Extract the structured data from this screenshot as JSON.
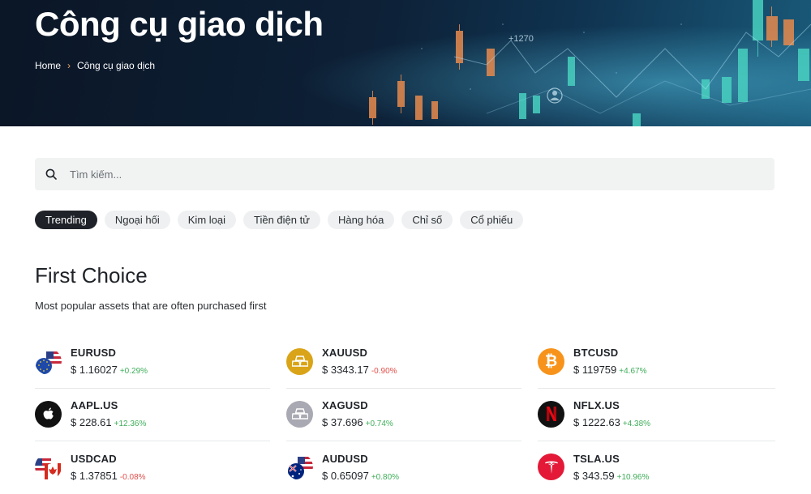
{
  "header": {
    "title": "Công cụ giao dịch",
    "breadcrumb": {
      "home": "Home",
      "separator": "›",
      "current": "Công cụ giao dịch"
    },
    "chart_labels": {
      "price_tag": "+1270"
    }
  },
  "search": {
    "placeholder": "Tìm kiếm..."
  },
  "categories": [
    "Trending",
    "Ngoại hối",
    "Kim loại",
    "Tiền điện tử",
    "Hàng hóa",
    "Chỉ số",
    "Cổ phiếu"
  ],
  "active_category": "Trending",
  "section": {
    "title": "First Choice",
    "subtitle": "Most popular assets that are often purchased first"
  },
  "assets": [
    {
      "symbol": "EURUSD",
      "price": "$ 1.16027",
      "change": "+0.29%",
      "direction": "up",
      "icon": "eu-us-flag-icon"
    },
    {
      "symbol": "XAUUSD",
      "price": "$ 3343.17",
      "change": "-0.90%",
      "direction": "down",
      "icon": "gold-bars-icon"
    },
    {
      "symbol": "BTCUSD",
      "price": "$ 119759",
      "change": "+4.67%",
      "direction": "up",
      "icon": "bitcoin-icon"
    },
    {
      "symbol": "AAPL.US",
      "price": "$ 228.61",
      "change": "+12.36%",
      "direction": "up",
      "icon": "apple-logo-icon"
    },
    {
      "symbol": "XAGUSD",
      "price": "$ 37.696",
      "change": "+0.74%",
      "direction": "up",
      "icon": "silver-bars-icon"
    },
    {
      "symbol": "NFLX.US",
      "price": "$ 1222.63",
      "change": "+4.38%",
      "direction": "up",
      "icon": "netflix-logo-icon"
    },
    {
      "symbol": "USDCAD",
      "price": "$ 1.37851",
      "change": "-0.08%",
      "direction": "down",
      "icon": "us-ca-flag-icon"
    },
    {
      "symbol": "AUDUSD",
      "price": "$ 0.65097",
      "change": "+0.80%",
      "direction": "up",
      "icon": "au-us-flag-icon"
    },
    {
      "symbol": "TSLA.US",
      "price": "$ 343.59",
      "change": "+10.96%",
      "direction": "up",
      "icon": "tesla-logo-icon"
    }
  ],
  "colors": {
    "up": "#3fae5a",
    "down": "#e0504b",
    "active_chip": "#1f2329",
    "chip": "#eef0f1",
    "gold": "#d9a417",
    "silver": "#a9a9b3",
    "bitcoin": "#f7931a",
    "netflix": "#111111",
    "tesla": "#e31937"
  }
}
